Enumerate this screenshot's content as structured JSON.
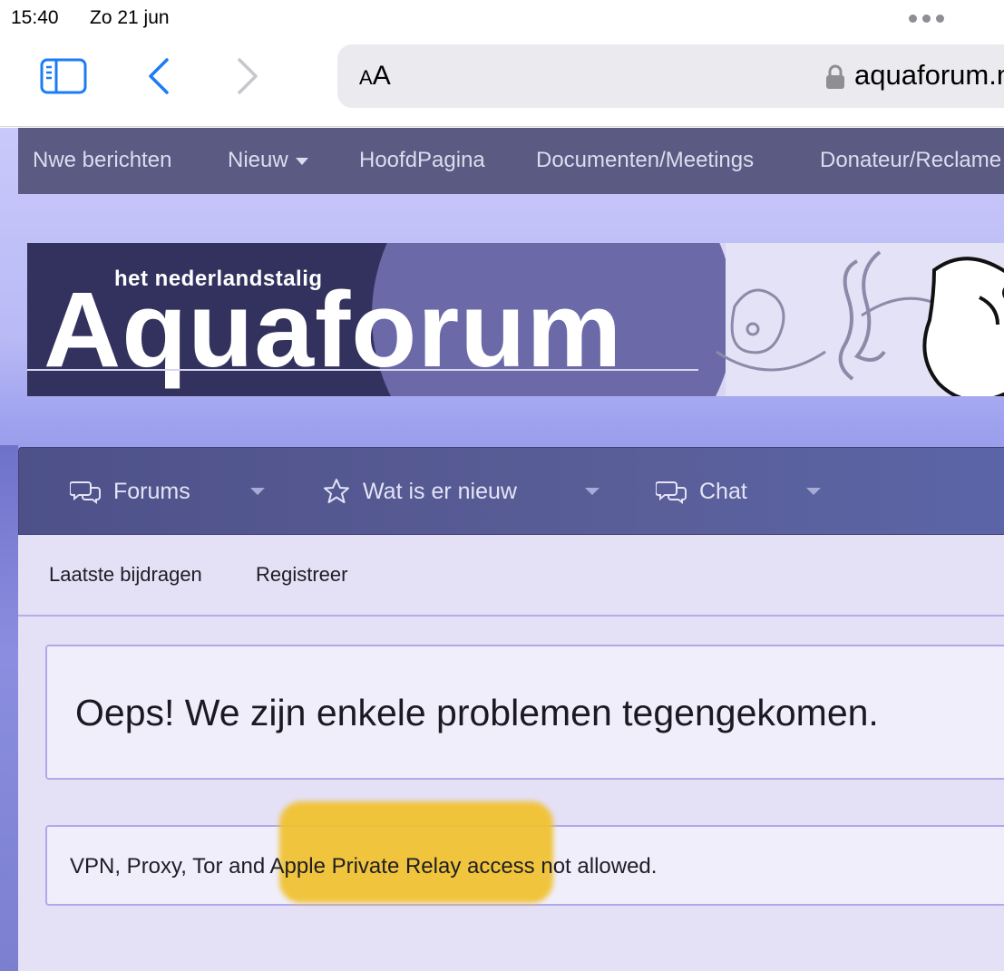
{
  "status_bar": {
    "time": "15:40",
    "date": "Zo 21 jun"
  },
  "browser": {
    "reader_label_small": "A",
    "reader_label_large": "A",
    "url": "aquaforum.nl",
    "icons": [
      "sidebar-icon",
      "chevron-left-icon",
      "chevron-right-icon",
      "lock-icon"
    ]
  },
  "top_nav": {
    "items": [
      "Nwe berichten",
      "Nieuw",
      "HoofdPagina",
      "Documenten/Meetings",
      "Donateur/Reclame"
    ]
  },
  "banner": {
    "subtitle": "het nederlandstalig",
    "title": "Aquaforum"
  },
  "main_nav": {
    "items": [
      {
        "label": "Forums",
        "icon": "chat-bubbles-icon"
      },
      {
        "label": "Wat is er nieuw",
        "icon": "star-icon"
      },
      {
        "label": "Chat",
        "icon": "chat-bubbles-icon"
      }
    ]
  },
  "sub_nav": {
    "items": [
      "Laatste bijdragen",
      "Registreer"
    ]
  },
  "error": {
    "title": "Oeps! We zijn enkele problemen tegengekomen.",
    "message": "VPN, Proxy, Tor and Apple Private Relay access not allowed."
  },
  "colors": {
    "top_nav_bg": "#5a5a82",
    "main_nav_bg": "#4e5189",
    "content_bg": "#e4e0f6",
    "box_border": "#b1a8ea",
    "highlight": "#f1c232",
    "safari_blue": "#1b7cf5"
  }
}
